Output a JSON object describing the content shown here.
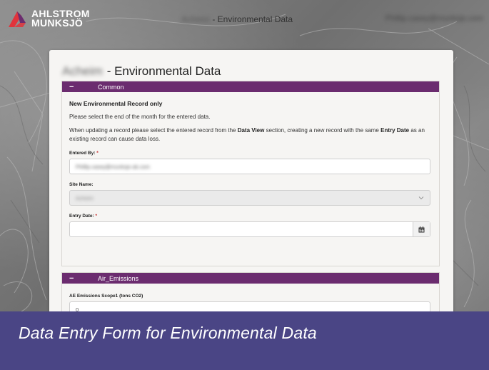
{
  "header": {
    "logo_line1": "AHLSTROM",
    "logo_line2": "MUNKSJÖ",
    "site_blurred": "Acheim",
    "title_suffix": " - Environmental Data",
    "user_blurred": "Phillip.casey@munksjo.com"
  },
  "page": {
    "site_blurred": "Acheim",
    "title": "- Environmental Data"
  },
  "common": {
    "header_label": "Common",
    "collapse_symbol": "−",
    "new_record_text": "New Environmental Record only",
    "select_month_text": "Please select the end of the month for the entered data.",
    "update_text_1": "When updating a record please select the entered record from the ",
    "update_bold_1": "Data View",
    "update_text_2": " section, creating a new record with the same ",
    "update_bold_2": "Entry Date",
    "update_text_3": " as an existing record can cause data loss.",
    "entered_by_label": "Entered By:",
    "entered_by_value": "Phillip.casey@munksjo-ak.com",
    "site_name_label": "Site Name:",
    "site_name_value": "Acheim",
    "entry_date_label": "Entry Date:",
    "entry_date_value": "",
    "required_mark": "*"
  },
  "air_emissions": {
    "header_label": "Air_Emissions",
    "collapse_symbol": "−",
    "scope1_label": "AE Emissions Scope1 (tons CO2)",
    "scope1_value": "0"
  },
  "caption": "Data Entry Form for Environmental Data",
  "colors": {
    "section_header": "#6b2c6f",
    "caption_bg": "#4a4585",
    "logo_red": "#e0343c",
    "logo_purple": "#6b2c6f"
  }
}
